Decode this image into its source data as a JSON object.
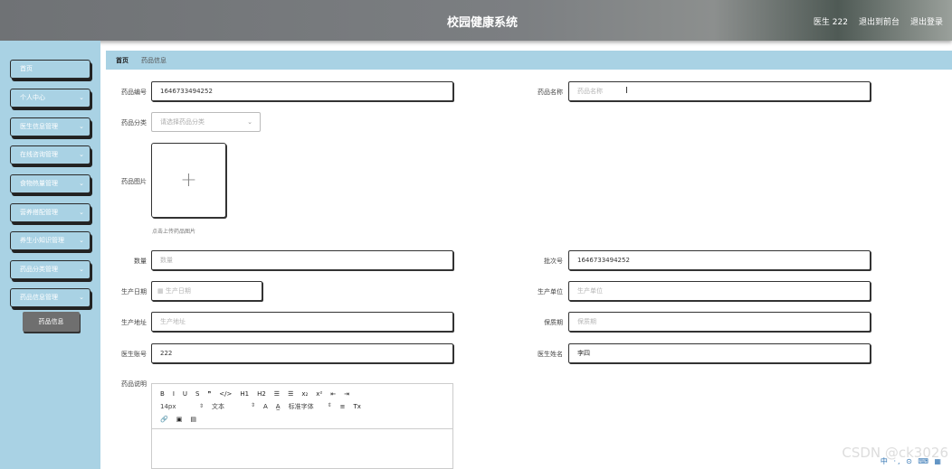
{
  "header": {
    "title": "校园健康系统",
    "user": "医生 222",
    "exit_admin": "退出到前台",
    "logout": "退出登录"
  },
  "sidebar": {
    "items": [
      {
        "label": "首页",
        "chevron": false
      },
      {
        "label": "个人中心",
        "chevron": true
      },
      {
        "label": "医生信息管理",
        "chevron": true
      },
      {
        "label": "在线咨询管理",
        "chevron": true
      },
      {
        "label": "食物热量管理",
        "chevron": true
      },
      {
        "label": "营养搭配管理",
        "chevron": true
      },
      {
        "label": "养生小知识管理",
        "chevron": true
      },
      {
        "label": "药品分类管理",
        "chevron": true
      },
      {
        "label": "药品信息管理",
        "chevron": true
      }
    ],
    "sub_item": "药品信息",
    "chevron_glyph": "⌄"
  },
  "breadcrumb": {
    "home": "首页",
    "current": "药品信息"
  },
  "form": {
    "code_label": "药品编号",
    "code_value": "1646733494252",
    "name_label": "药品名称",
    "name_placeholder": "药品名称",
    "category_label": "药品分类",
    "category_placeholder": "请选择药品分类",
    "image_label": "药品图片",
    "image_hint": "点击上传药品图片",
    "qty_label": "数量",
    "qty_placeholder": "数量",
    "batch_label": "批次号",
    "batch_value": "1646733494252",
    "prod_date_label": "生产日期",
    "prod_date_placeholder": "生产日期",
    "maker_label": "生产单位",
    "maker_placeholder": "生产单位",
    "address_label": "生产地址",
    "address_placeholder": "生产地址",
    "shelf_label": "保质期",
    "shelf_placeholder": "保质期",
    "doctor_acct_label": "医生账号",
    "doctor_acct_value": "222",
    "doctor_name_label": "医生姓名",
    "doctor_name_value": "李四",
    "desc_label": "药品说明"
  },
  "editor": {
    "row1": [
      "B",
      "I",
      "U",
      "S",
      "❞",
      "</>",
      "H1",
      "H2",
      "☰",
      "☰",
      "x₂",
      "x²",
      "⇤",
      "⇥"
    ],
    "size": "14px",
    "block": "文本",
    "color": "A",
    "bg": "A̲",
    "font": "标准字体",
    "align": "≡",
    "clear": "Tx",
    "row3": [
      "🔗",
      "▣",
      "▤"
    ]
  },
  "watermark": "CSDN @ck3026",
  "tray": "中 ·, ⊙ ⌨ ▦"
}
